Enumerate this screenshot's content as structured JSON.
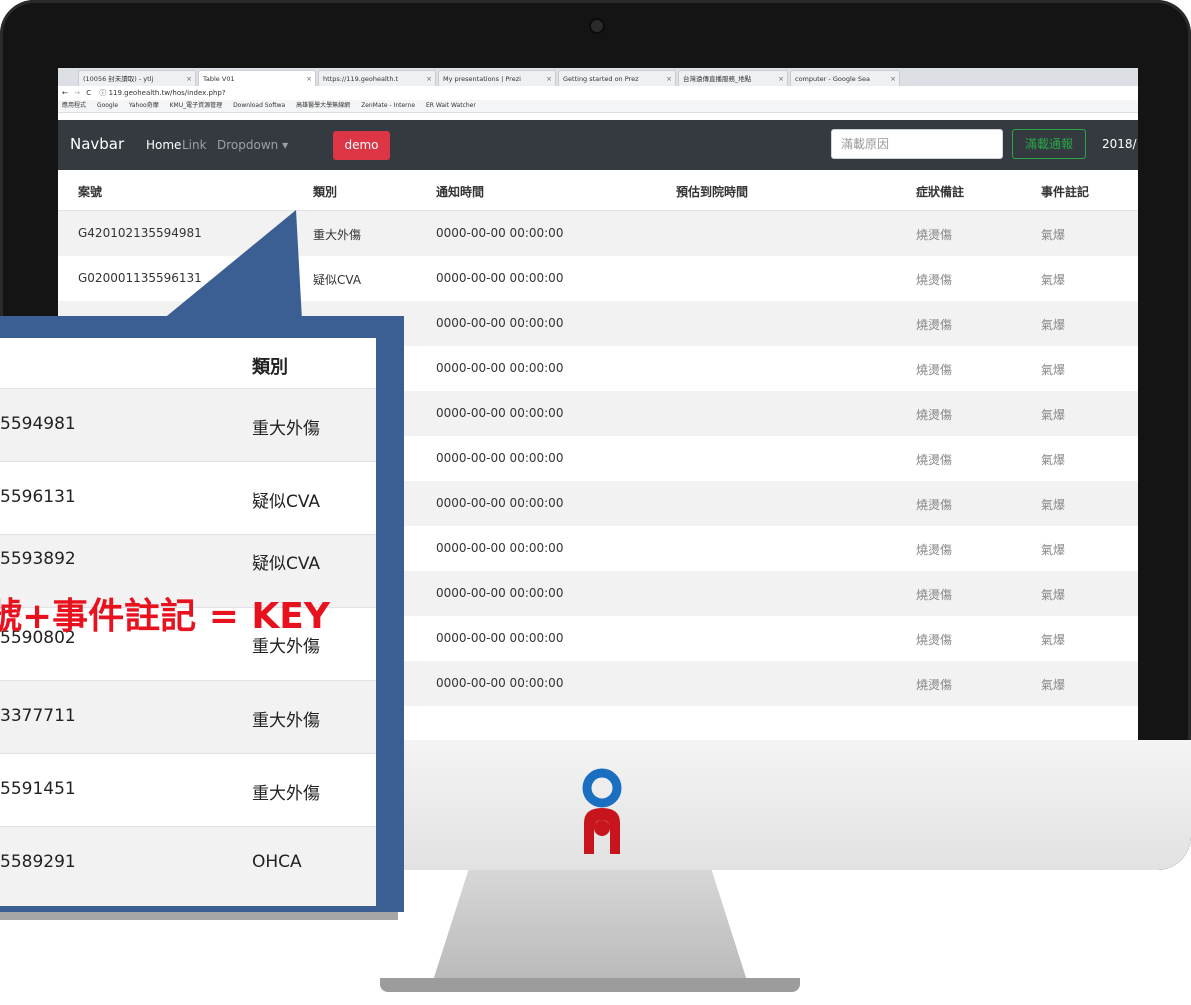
{
  "browser": {
    "tabs": [
      {
        "label": "(10056 封未讀取) - ytlj"
      },
      {
        "label": "Table V01"
      },
      {
        "label": "https://119.geohealth.t"
      },
      {
        "label": "My presentations | Prezi"
      },
      {
        "label": "Getting started on Prez"
      },
      {
        "label": "台灣遠傳直播服務_地點"
      },
      {
        "label": "computer - Google Sea"
      }
    ],
    "url": "119.geohealth.tw/hos/index.php?",
    "bookmarks": [
      "應用程式",
      "Google",
      "Yahoo奇摩",
      "KMU_電子資源管理",
      "Download Softwa",
      "高雄醫學大學無線網",
      "ZenMate - Interne",
      "ER Wait Watcher"
    ]
  },
  "navbar": {
    "brand": "Navbar",
    "home": "Home",
    "link": "Link",
    "dropdown": "Dropdown ▾",
    "demo": "demo",
    "search_placeholder": "滿載原因",
    "notify_button": "滿載通報",
    "date": "2018/"
  },
  "table": {
    "headers": {
      "case_no": "案號",
      "category": "類別",
      "notify_time": "通知時間",
      "eta": "預估到院時間",
      "symptom": "症狀備註",
      "event": "事件註記"
    },
    "rows": [
      {
        "case_no": "G420102135594981",
        "category": "重大外傷",
        "notify_time": "0000-00-00 00:00:00",
        "symptom": "燒燙傷",
        "event": "氣爆"
      },
      {
        "case_no": "G020001135596131",
        "category": "疑似CVA",
        "notify_time": "0000-00-00 00:00:00",
        "symptom": "燒燙傷",
        "event": "氣爆"
      },
      {
        "case_no": "",
        "category": "",
        "notify_time": "0000-00-00 00:00:00",
        "symptom": "燒燙傷",
        "event": "氣爆"
      },
      {
        "case_no": "",
        "category": "",
        "notify_time": "0000-00-00 00:00:00",
        "symptom": "燒燙傷",
        "event": "氣爆"
      },
      {
        "case_no": "",
        "category": "",
        "notify_time": "0000-00-00 00:00:00",
        "symptom": "燒燙傷",
        "event": "氣爆"
      },
      {
        "case_no": "",
        "category": "",
        "notify_time": "0000-00-00 00:00:00",
        "symptom": "燒燙傷",
        "event": "氣爆"
      },
      {
        "case_no": "",
        "category": "",
        "notify_time": "0000-00-00 00:00:00",
        "symptom": "燒燙傷",
        "event": "氣爆"
      },
      {
        "case_no": "",
        "category": "",
        "notify_time": "0000-00-00 00:00:00",
        "symptom": "燒燙傷",
        "event": "氣爆"
      },
      {
        "case_no": "",
        "category": "",
        "notify_time": "0000-00-00 00:00:00",
        "symptom": "燒燙傷",
        "event": "氣爆"
      },
      {
        "case_no": "",
        "category": "",
        "notify_time": "0000-00-00 00:00:00",
        "symptom": "燒燙傷",
        "event": "氣爆"
      },
      {
        "case_no": "",
        "category": "",
        "notify_time": "0000-00-00 00:00:00",
        "symptom": "燒燙傷",
        "event": "氣爆"
      }
    ]
  },
  "callout": {
    "header": "類別",
    "rows": [
      {
        "id": "5594981",
        "category": "重大外傷"
      },
      {
        "id": "5596131",
        "category": "疑似CVA"
      },
      {
        "id": "5593892",
        "category": "疑似CVA"
      },
      {
        "id": "5590802",
        "category": "重大外傷"
      },
      {
        "id": "3377711",
        "category": "重大外傷"
      },
      {
        "id": "5591451",
        "category": "重大外傷"
      },
      {
        "id": "5589291",
        "category": "OHCA"
      }
    ],
    "key_label": "號+事件註記 = KEY",
    "key_color": "#e8121f",
    "border_color": "#2e4a7a"
  }
}
